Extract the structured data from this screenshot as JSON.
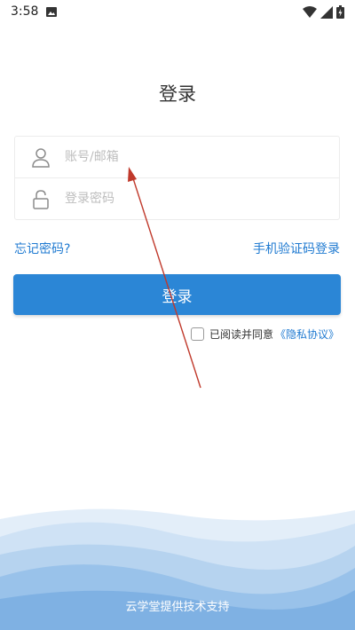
{
  "status_bar": {
    "time": "3:58",
    "icons": [
      "image-icon",
      "wifi-icon",
      "signal-icon",
      "battery-icon"
    ]
  },
  "login": {
    "title": "登录",
    "account_placeholder": "账号/邮箱",
    "account_value": "",
    "password_placeholder": "登录密码",
    "password_value": "",
    "forgot_password": "忘记密码?",
    "sms_login": "手机验证码登录",
    "login_button": "登录",
    "agree_text": "已阅读并同意",
    "privacy_link": "《隐私协议》",
    "agree_checked": false
  },
  "footer": {
    "support_text": "云学堂提供技术支持"
  },
  "colors": {
    "accent": "#2b86d6",
    "link": "#1f7ad1",
    "annotation_arrow": "#c0392b"
  }
}
